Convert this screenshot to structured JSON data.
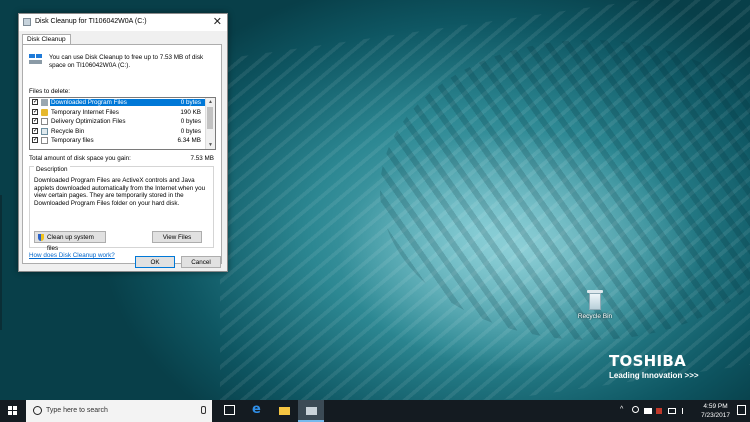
{
  "desktop": {
    "recycle_bin_label": "Recycle Bin",
    "brand_name": "TOSHIBA",
    "brand_tagline": "Leading Innovation >>>"
  },
  "dialog": {
    "title": "Disk Cleanup for TI106042W0A (C:)",
    "close_glyph": "✕",
    "tab_label": "Disk Cleanup",
    "intro_text": "You can use Disk Cleanup to free up to 7.53 MB of disk space on TI106042W0A (C:).",
    "files_to_delete_label": "Files to delete:",
    "files": [
      {
        "name": "Downloaded Program Files",
        "size": "0 bytes",
        "checked": true,
        "selected": true
      },
      {
        "name": "Temporary Internet Files",
        "size": "190 KB",
        "checked": true,
        "selected": false
      },
      {
        "name": "Delivery Optimization Files",
        "size": "0 bytes",
        "checked": true,
        "selected": false
      },
      {
        "name": "Recycle Bin",
        "size": "0 bytes",
        "checked": true,
        "selected": false
      },
      {
        "name": "Temporary files",
        "size": "6.34 MB",
        "checked": true,
        "selected": false
      }
    ],
    "total_label": "Total amount of disk space you gain:",
    "total_value": "7.53 MB",
    "description_legend": "Description",
    "description_text": "Downloaded Program Files are ActiveX controls and Java applets downloaded automatically from the Internet when you view certain pages. They are temporarily stored in the Downloaded Program Files folder on your hard disk.",
    "cleanup_system_label": "Clean up system files",
    "view_files_label": "View Files",
    "help_link": "How does Disk Cleanup work?",
    "ok_label": "OK",
    "cancel_label": "Cancel"
  },
  "taskbar": {
    "search_placeholder": "Type here to search",
    "edge_glyph": "e",
    "tray_icons": [
      "wifi-icon",
      "volume-icon",
      "network-icon"
    ],
    "time": "4:59 PM",
    "date": "7/23/2017"
  }
}
